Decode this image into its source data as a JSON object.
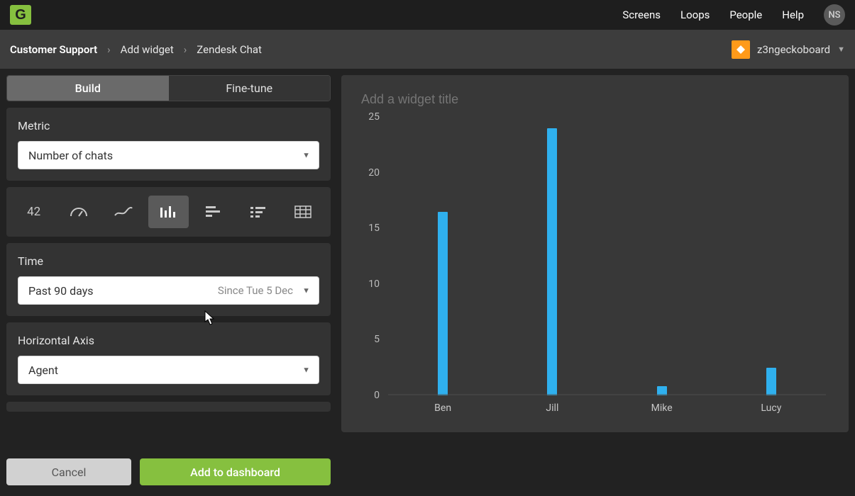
{
  "app": {
    "logo_letter": "G"
  },
  "topnav": {
    "items": [
      "Screens",
      "Loops",
      "People",
      "Help"
    ],
    "avatar": "NS"
  },
  "breadcrumbs": {
    "items": [
      {
        "label": "Customer Support",
        "strong": true
      },
      {
        "label": "Add widget",
        "strong": false
      },
      {
        "label": "Zendesk Chat",
        "strong": false
      }
    ],
    "separator": "›"
  },
  "account": {
    "name": "z3ngeckoboard"
  },
  "tabs": {
    "build": "Build",
    "finetune": "Fine-tune",
    "active": "build"
  },
  "metric_panel": {
    "label": "Metric",
    "value": "Number of chats"
  },
  "viz_types": {
    "number_label": "42",
    "options": [
      "number",
      "gauge",
      "line",
      "column",
      "bar",
      "leaderboard",
      "table"
    ],
    "selected": "column"
  },
  "time_panel": {
    "label": "Time",
    "value": "Past 90 days",
    "hint": "Since Tue 5 Dec"
  },
  "haxis_panel": {
    "label": "Horizontal Axis",
    "value": "Agent"
  },
  "actions": {
    "cancel": "Cancel",
    "add": "Add to dashboard"
  },
  "preview": {
    "title_placeholder": "Add a widget title"
  },
  "chart_data": {
    "type": "bar",
    "title": "",
    "xlabel": "",
    "ylabel": "",
    "ylim": [
      0,
      25
    ],
    "yticks": [
      0,
      5,
      10,
      15,
      20,
      25
    ],
    "categories": [
      "Ben",
      "Jill",
      "Mike",
      "Lucy"
    ],
    "values": [
      16.5,
      24,
      0.8,
      2.5
    ]
  },
  "colors": {
    "accent_green": "#86c03f",
    "bar_blue": "#2fb0ee",
    "account_orange": "#ff9a1a"
  }
}
